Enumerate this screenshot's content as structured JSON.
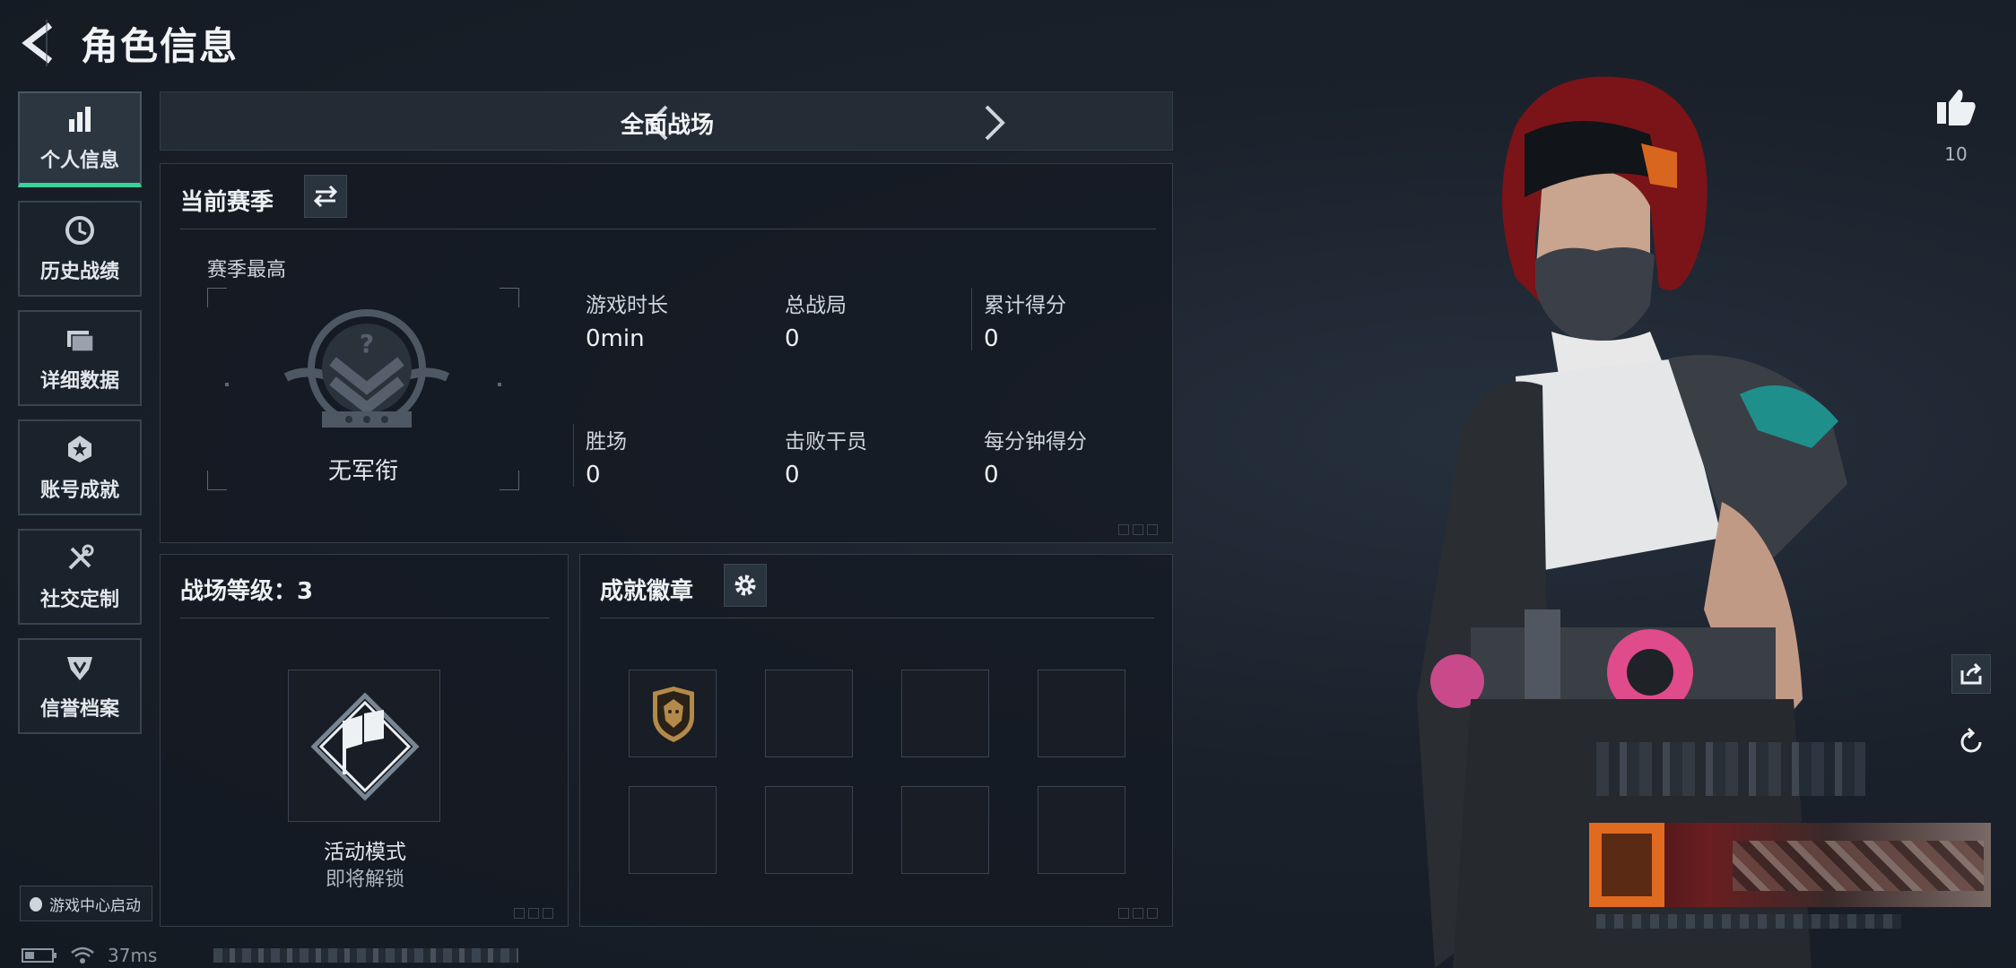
{
  "header": {
    "title": "角色信息"
  },
  "sidebar": {
    "items": [
      {
        "label": "个人信息",
        "icon": "bar-chart-icon",
        "active": true
      },
      {
        "label": "历史战绩",
        "icon": "clock-icon",
        "active": false
      },
      {
        "label": "详细数据",
        "icon": "folder-icon",
        "active": false
      },
      {
        "label": "账号成就",
        "icon": "medal-icon",
        "active": false
      },
      {
        "label": "社交定制",
        "icon": "tools-icon",
        "active": false
      },
      {
        "label": "信誉档案",
        "icon": "shield-icon",
        "active": false
      }
    ],
    "game_center_label": "游戏中心启动"
  },
  "status": {
    "ping": "37ms"
  },
  "mode": {
    "title": "全面战场"
  },
  "season": {
    "title": "当前赛季",
    "best_label": "赛季最高",
    "rank_label": "无军衔",
    "stats": [
      {
        "label": "游戏时长",
        "value": "0min"
      },
      {
        "label": "总战局",
        "value": "0"
      },
      {
        "label": "累计得分",
        "value": "0"
      },
      {
        "label": "胜场",
        "value": "0"
      },
      {
        "label": "击败干员",
        "value": "0"
      },
      {
        "label": "每分钟得分",
        "value": "0"
      }
    ]
  },
  "battlefield_level": {
    "title": "战场等级：3",
    "mode_name": "活动模式",
    "mode_status": "即将解锁"
  },
  "achievements": {
    "title": "成就徽章",
    "slots_total": 8,
    "slots_filled": 1
  },
  "social": {
    "like_count": "10"
  },
  "colors": {
    "accent": "#36d39a",
    "badge_gold": "#b48a4a"
  }
}
